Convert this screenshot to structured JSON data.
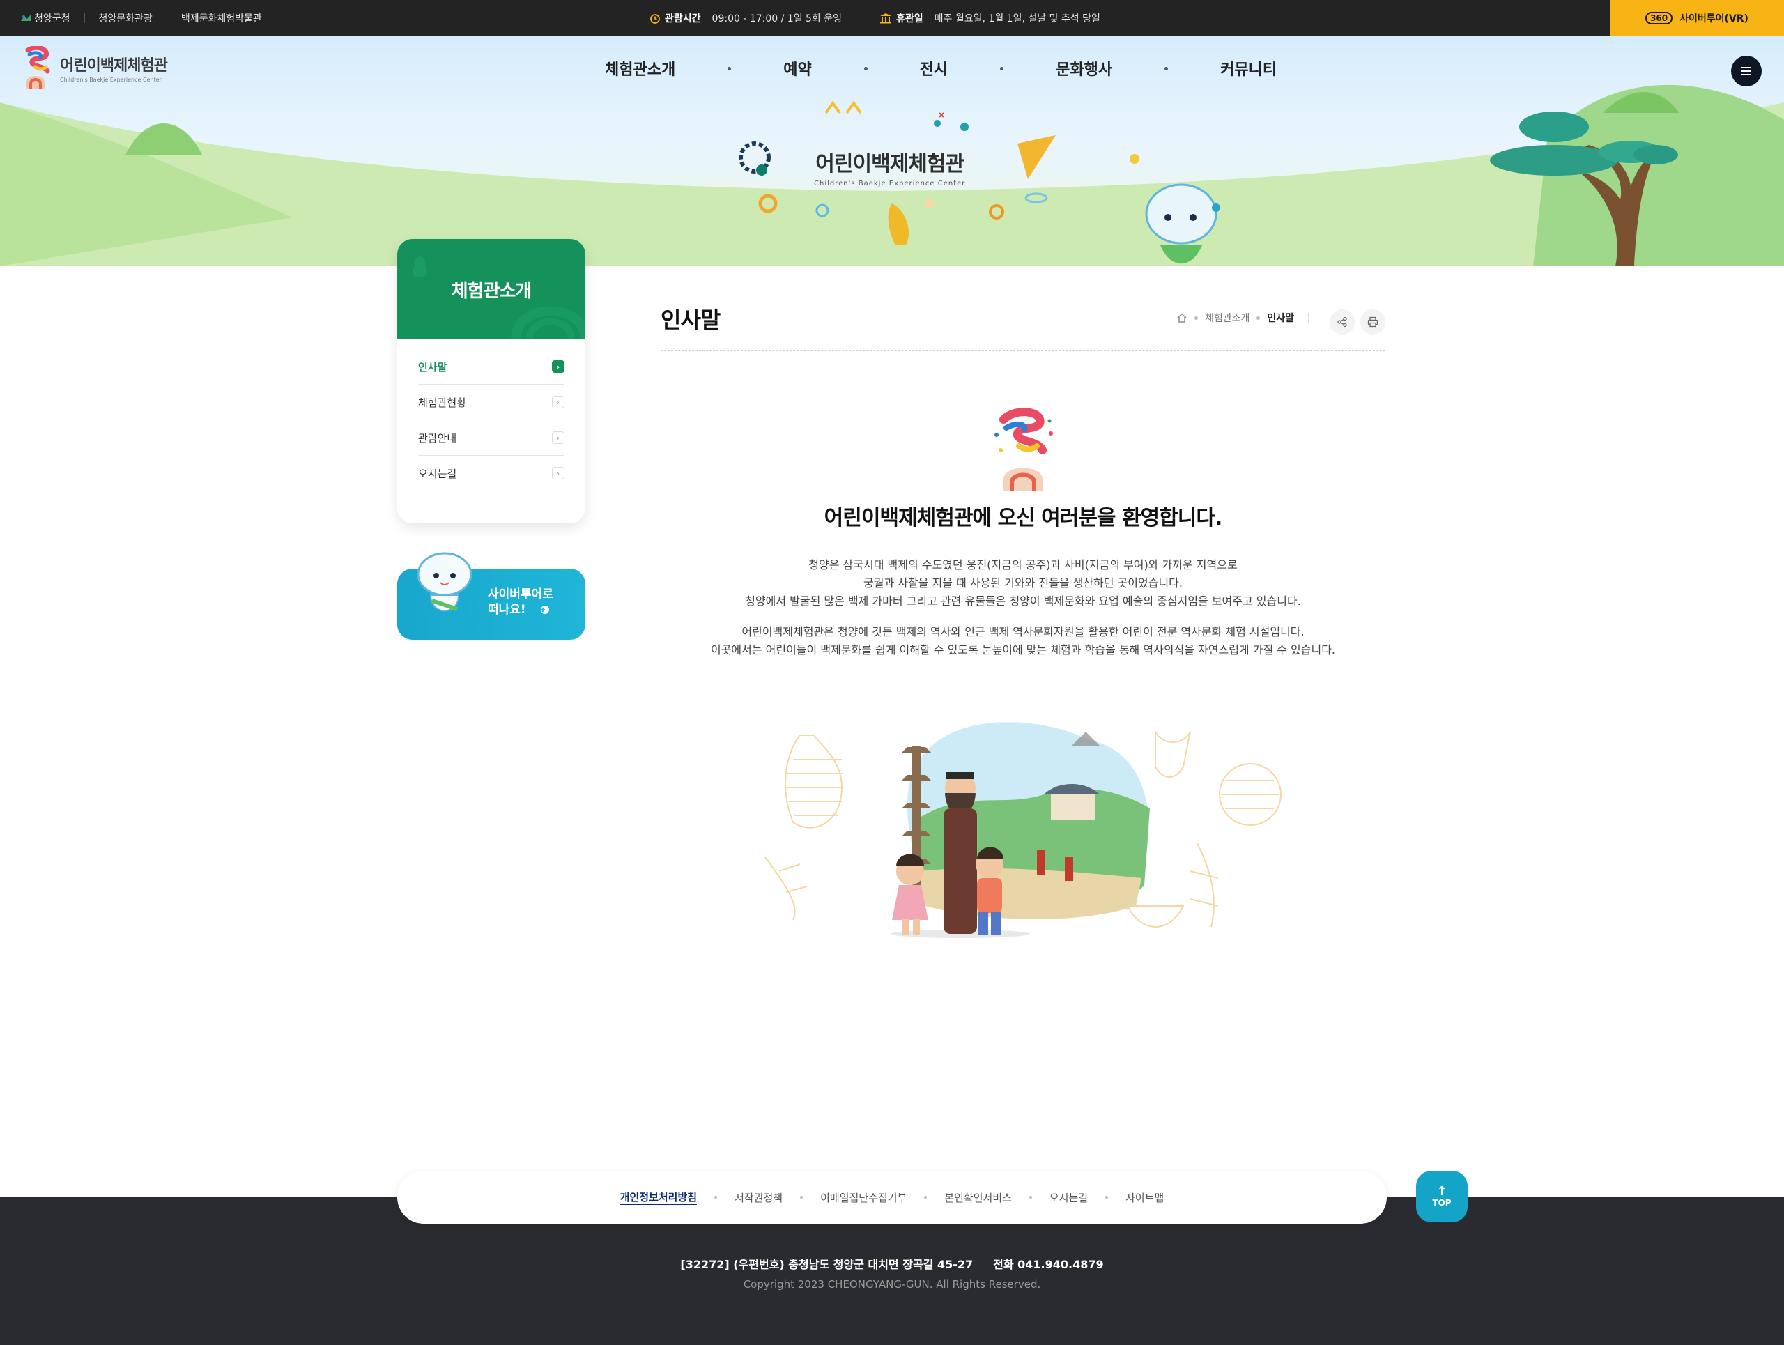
{
  "topbar": {
    "links": [
      "청양군청",
      "청양문화관광",
      "백제문화체험박물관"
    ],
    "hours_label": "관람시간",
    "hours_value": "09:00 - 17:00 / 1일 5회 운영",
    "closed_label": "휴관일",
    "closed_value": "매주 월요일, 1월 1일, 설날 및 추석 당일",
    "vr_badge": "360",
    "vr_label": "사이버투어(VR)"
  },
  "header": {
    "logo_ko": "어린이백제체험관",
    "logo_en": "Children's Baekje Experience Center",
    "nav": [
      "체험관소개",
      "예약",
      "전시",
      "문화행사",
      "커뮤니티"
    ]
  },
  "hero": {
    "title_ko": "어린이백제체험관",
    "title_en": "Children's Baekje Experience Center"
  },
  "sidebar": {
    "title": "체험관소개",
    "items": [
      {
        "label": "인사말",
        "active": true
      },
      {
        "label": "체험관현황",
        "active": false
      },
      {
        "label": "관람안내",
        "active": false
      },
      {
        "label": "오시는길",
        "active": false
      }
    ],
    "banner_line1": "사이버투어로",
    "banner_line2": "떠나요!"
  },
  "content": {
    "page_title": "인사말",
    "breadcrumb": [
      "체험관소개",
      "인사말"
    ],
    "welcome": "어린이백제체험관에 오신 여러분을 환영합니다.",
    "para1": [
      "청양은 삼국시대 백제의 수도였던 웅진(지금의 공주)과 사비(지금의 부여)와 가까운 지역으로",
      "궁궐과 사찰을 지을 때 사용된 기와와 전돌을 생산하던 곳이었습니다.",
      "청양에서 발굴된 많은 백제 가마터 그리고 관련 유물들은 청양이 백제문화와 요업 예술의 중심지임을 보여주고 있습니다."
    ],
    "para2": [
      "어린이백제체험관은 청양에 깃든 백제의 역사와 인근 백제 역사문화자원을 활용한 어린이 전문 역사문화 체험 시설입니다.",
      "이곳에서는 어린이들이 백제문화를 쉽게 이해할 수 있도록 눈높이에 맞는 체험과 학습을 통해 역사의식을 자연스럽게 가질 수 있습니다."
    ]
  },
  "footer": {
    "links": [
      "개인정보처리방침",
      "저작권정책",
      "이메일집단수집거부",
      "본인확인서비스",
      "오시는길",
      "사이트맵"
    ],
    "top_label": "TOP",
    "address": "[32272] (우편번호) 충청남도 청양군 대치면 장곡길 45-27",
    "phone": "전화 041.940.4879",
    "copyright": "Copyright 2023 CHEONGYANG-GUN. All Rights Reserved."
  },
  "colors": {
    "topbar_bg": "#232323",
    "vr_accent": "#f8b415",
    "brand_green": "#15915c",
    "banner_blue": "#1fb6d8",
    "footer_bg": "#2a2b30",
    "top_button": "#14a4c8"
  }
}
